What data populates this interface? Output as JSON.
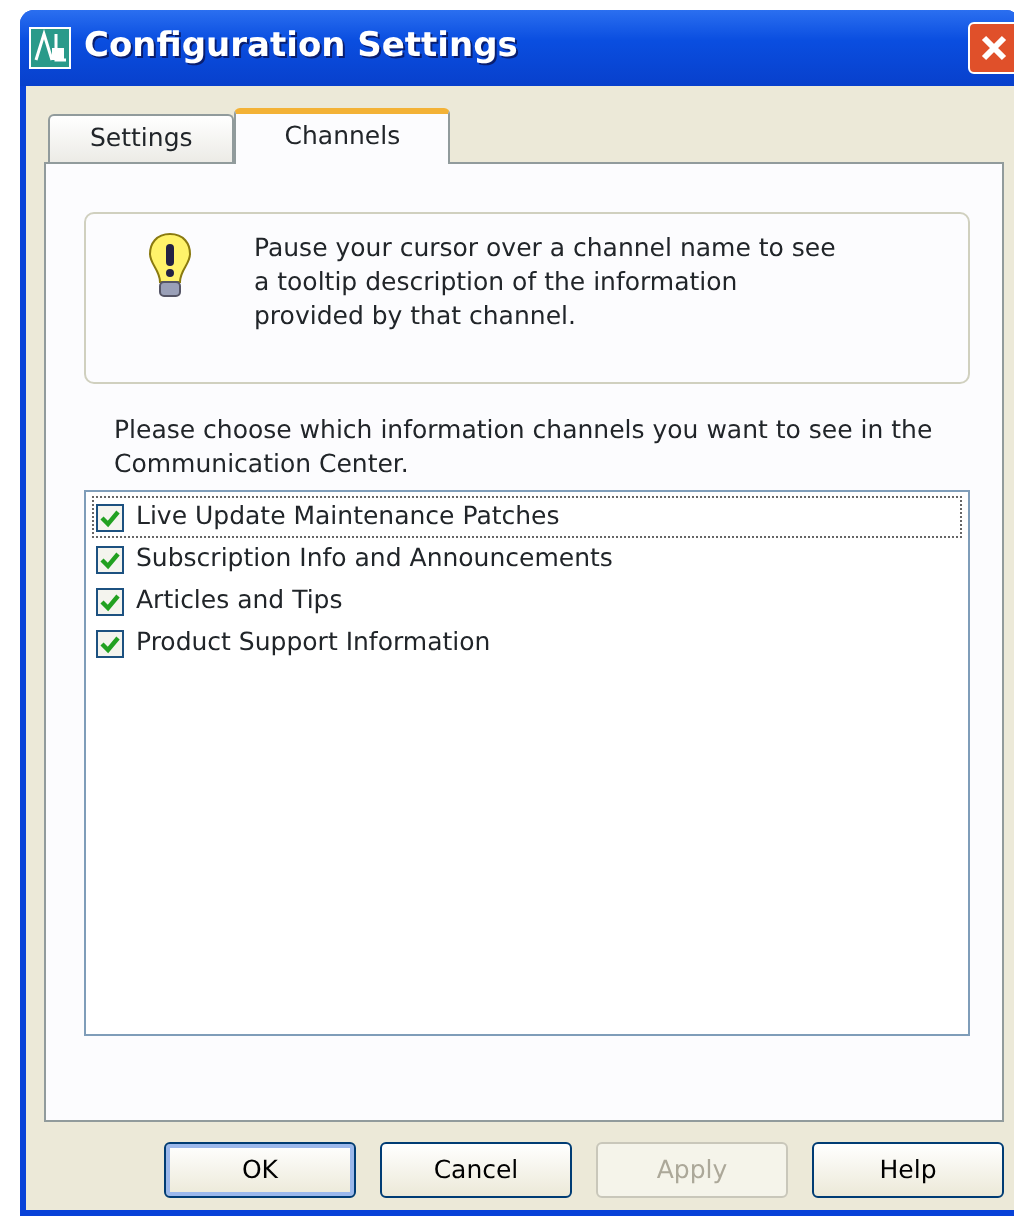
{
  "window": {
    "title": "Configuration Settings"
  },
  "tabs": [
    {
      "label": "Settings",
      "selected": false
    },
    {
      "label": "Channels",
      "selected": true
    }
  ],
  "info": {
    "text": "Pause your cursor over a channel name to see a tooltip description of the information provided by that channel."
  },
  "prompt": "Please choose which information channels you want to see in the Communication Center.",
  "channels": [
    {
      "label": "Live Update Maintenance Patches",
      "checked": true,
      "focused": true
    },
    {
      "label": "Subscription Info and Announcements",
      "checked": true,
      "focused": false
    },
    {
      "label": "Articles and Tips",
      "checked": true,
      "focused": false
    },
    {
      "label": "Product Support Information",
      "checked": true,
      "focused": false
    }
  ],
  "buttons": [
    {
      "label": "OK",
      "disabled": false,
      "default": true
    },
    {
      "label": "Cancel",
      "disabled": false,
      "default": false
    },
    {
      "label": "Apply",
      "disabled": true,
      "default": false
    },
    {
      "label": "Help",
      "disabled": false,
      "default": false
    }
  ]
}
